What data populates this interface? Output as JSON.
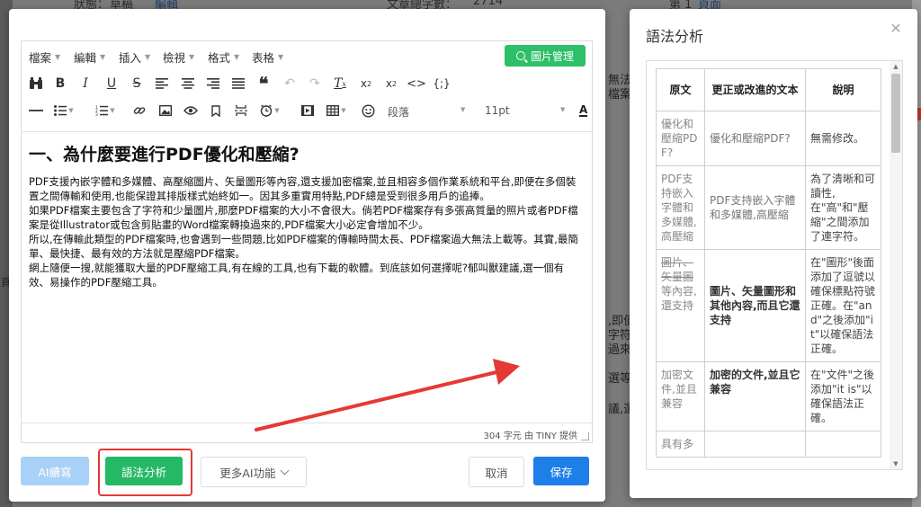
{
  "background": {
    "top_items": [
      "狀態：",
      "草稿",
      "編輯",
      "文章總字數：",
      "2714",
      "第 1 ",
      "頁面"
    ],
    "right_fragments": [
      "無法",
      "檔案",
      ",即便",
      "字符和",
      "過來的",
      "選等。",
      "議,選"
    ],
    "left_fragment": "頁"
  },
  "editor": {
    "menubar": {
      "items": [
        {
          "label": "檔案"
        },
        {
          "label": "編輯"
        },
        {
          "label": "插入"
        },
        {
          "label": "檢視"
        },
        {
          "label": "格式"
        },
        {
          "label": "表格"
        }
      ],
      "image_manage_label": "圖片管理"
    },
    "toolbar": {
      "row1_icons": [
        "find-replace-icon",
        "bold-icon",
        "italic-icon",
        "underline-icon",
        "strikethrough-icon",
        "align-left-icon",
        "align-center-icon",
        "align-right-icon",
        "align-justify-icon",
        "blockquote-icon",
        "undo-icon",
        "redo-icon",
        "clear-format-icon",
        "subscript-icon",
        "superscript-icon",
        "code-icon",
        "code-block-icon"
      ],
      "row2_icons": [
        "horizontal-rule-icon",
        "bullet-list-icon",
        "numbered-list-icon",
        "link-icon",
        "image-icon",
        "preview-icon",
        "bookmark-icon",
        "page-break-icon",
        "clock-icon",
        "media-icon",
        "table-icon",
        "emoji-icon"
      ],
      "paragraph_label": "段落",
      "font_size_label": "11pt",
      "text_color_label": "A",
      "bg_color_label": "A"
    },
    "content": {
      "heading": "一、為什麼要進行PDF優化和壓縮?",
      "paragraphs": [
        "PDF支援內嵌字體和多媒體、高壓縮圖片、矢量圖形等內容,還支援加密檔案,並且相容多個作業系統和平台,即便在多個裝置之間傳輸和使用,也能保證其排版樣式始終如一。因其多重實用特點,PDF總是受到很多用戶的追捧。",
        "如果PDF檔案主要包含了字符和少量圖片,那麼PDF檔案的大小不會很大。倘若PDF檔案存有多張高質量的照片或者PDF檔案是從Illustrator或包含剪貼畫的Word檔案轉換過來的,PDF檔案大小必定會增加不少。",
        "所以,在傳輸此類型的PDF檔案時,也會遇到一些問題,比如PDF檔案的傳輸時間太長、PDF檔案過大無法上載等。其實,最簡單、最快捷、最有效的方法就是壓縮PDF檔案。",
        "網上隨便一搜,就能獲取大量的PDF壓縮工具,有在線的工具,也有下載的軟體。到底該如何選擇呢?郁叫獸建議,選一個有效、易操作的PDF壓縮工具。"
      ]
    },
    "status": "304 字元 由 TINY 提供"
  },
  "footer": {
    "ai_write_label": "AI續寫",
    "grammar_label": "語法分析",
    "more_ai_label": "更多AI功能",
    "cancel_label": "取消",
    "save_label": "保存"
  },
  "panel": {
    "title": "語法分析",
    "close_icon": "close-icon",
    "table": {
      "headers": [
        "原文",
        "更正或改進的文本",
        "說明"
      ],
      "rows": [
        {
          "original": "優化和壓縮PDF?",
          "original_struck": "",
          "original_rest": "",
          "fix": "優化和壓縮PDF?",
          "fix_bold": false,
          "note": "無需修改。"
        },
        {
          "original": "PDF支持嵌入字體和多媒體,高壓縮",
          "original_struck": "",
          "original_rest": "",
          "fix": "PDF支持嵌入字體和多媒體,高壓縮",
          "fix_bold": false,
          "note": "為了清晰和可讀性,在\"高\"和\"壓縮\"之間添加了連字符。"
        },
        {
          "original": "",
          "original_struck": "圖片、矢量圖",
          "original_rest": "等內容,還支持",
          "fix": "圖片、矢量圖形和其他內容,而且它還支持",
          "fix_bold": true,
          "note": "在\"圖形\"後面添加了逗號以確保標點符號正確。在\"and\"之後添加\"it\"以確保語法正確。"
        },
        {
          "original": "加密文件,並且兼容",
          "original_struck": "",
          "original_rest": "",
          "fix": "加密的文件,並且它兼容",
          "fix_bold": true,
          "note": "在\"文件\"之後添加\"it is\"以確保語法正確。"
        },
        {
          "original": "具有多",
          "original_struck": "",
          "original_rest": "",
          "fix": "",
          "fix_bold": false,
          "note": ""
        }
      ]
    }
  },
  "colors": {
    "green": "#25b865",
    "blue": "#1e7fe8",
    "light_blue": "#a8d1f7",
    "annotation_red": "#e53935"
  }
}
